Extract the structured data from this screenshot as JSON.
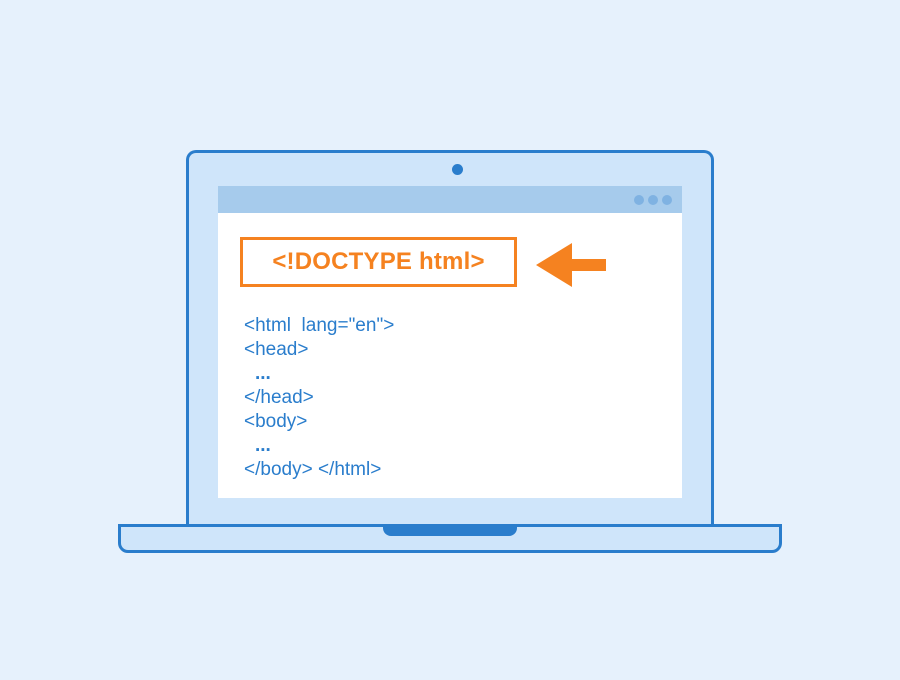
{
  "laptop": {
    "screen": {
      "window_controls": [
        "dot",
        "dot",
        "dot"
      ],
      "highlight": {
        "text": "<!DOCTYPE html>",
        "color": "#f58220"
      },
      "pointer": {
        "icon": "arrow-left-icon",
        "color": "#f58220"
      },
      "code_lines": [
        "<html  lang=\"en\">",
        "<head>",
        "...",
        "</head>",
        "<body>",
        "...",
        "</body> </html>"
      ],
      "code_color": "#2a7dcc"
    },
    "frame_color": "#2a7dcc",
    "body_color": "#cfe5fa"
  },
  "background_color": "#e6f1fc"
}
